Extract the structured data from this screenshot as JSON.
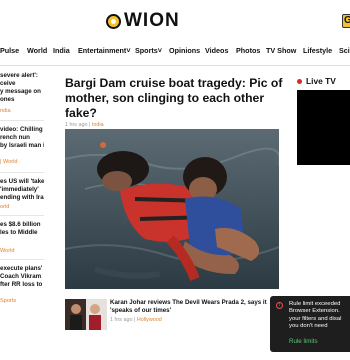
{
  "header": {
    "logo_text": "WION",
    "corner_badge": "G"
  },
  "nav": {
    "items": [
      "Pulse",
      "World",
      "India",
      "Entertainment",
      "Sports",
      "Opinions",
      "Videos",
      "Photos",
      "TV Show",
      "Lifestyle",
      "Scie"
    ]
  },
  "left_stories": [
    {
      "lines": [
        "severe alert':",
        "ceive",
        "y message on",
        "ones"
      ],
      "category": "ndia"
    },
    {
      "lines": [
        "video: Chilling",
        "rench nun",
        "by Israeli man in"
      ],
      "category": "| World"
    },
    {
      "lines": [
        "es US will 'take",
        "'immediately'",
        "ending with Iran"
      ],
      "category": "orld"
    },
    {
      "lines": [
        "es $8.6 billion",
        "les to Middle"
      ],
      "category": "World"
    },
    {
      "lines": [
        "execute plans'",
        "Coach Vikram",
        "fter RR loss to"
      ],
      "category": "Sports"
    }
  ],
  "article": {
    "headline": "Bargi Dam cruise boat tragedy: Pic of mother, son clinging to each other fake?",
    "time": "1 hrs ago",
    "category": "India"
  },
  "related": {
    "title": "Karan Johar reviews The Devil Wears Prada 2, says it 'speaks of our times'",
    "time": "1 hrs ago",
    "category": "Hollywood"
  },
  "live": {
    "label": "Live TV"
  },
  "toast": {
    "lines": [
      "Rule limit exceeded",
      "Browser Extension.",
      "your filters and disal",
      "you don't need"
    ],
    "link": "Rule limits",
    "icon": "alert-circle-icon"
  },
  "colors": {
    "accent": "#e0832e",
    "live_dot": "#d72a2a",
    "toast_bg": "#1e1e1e",
    "toast_link": "#5cc27a",
    "logo_yellow": "#f2c230"
  }
}
